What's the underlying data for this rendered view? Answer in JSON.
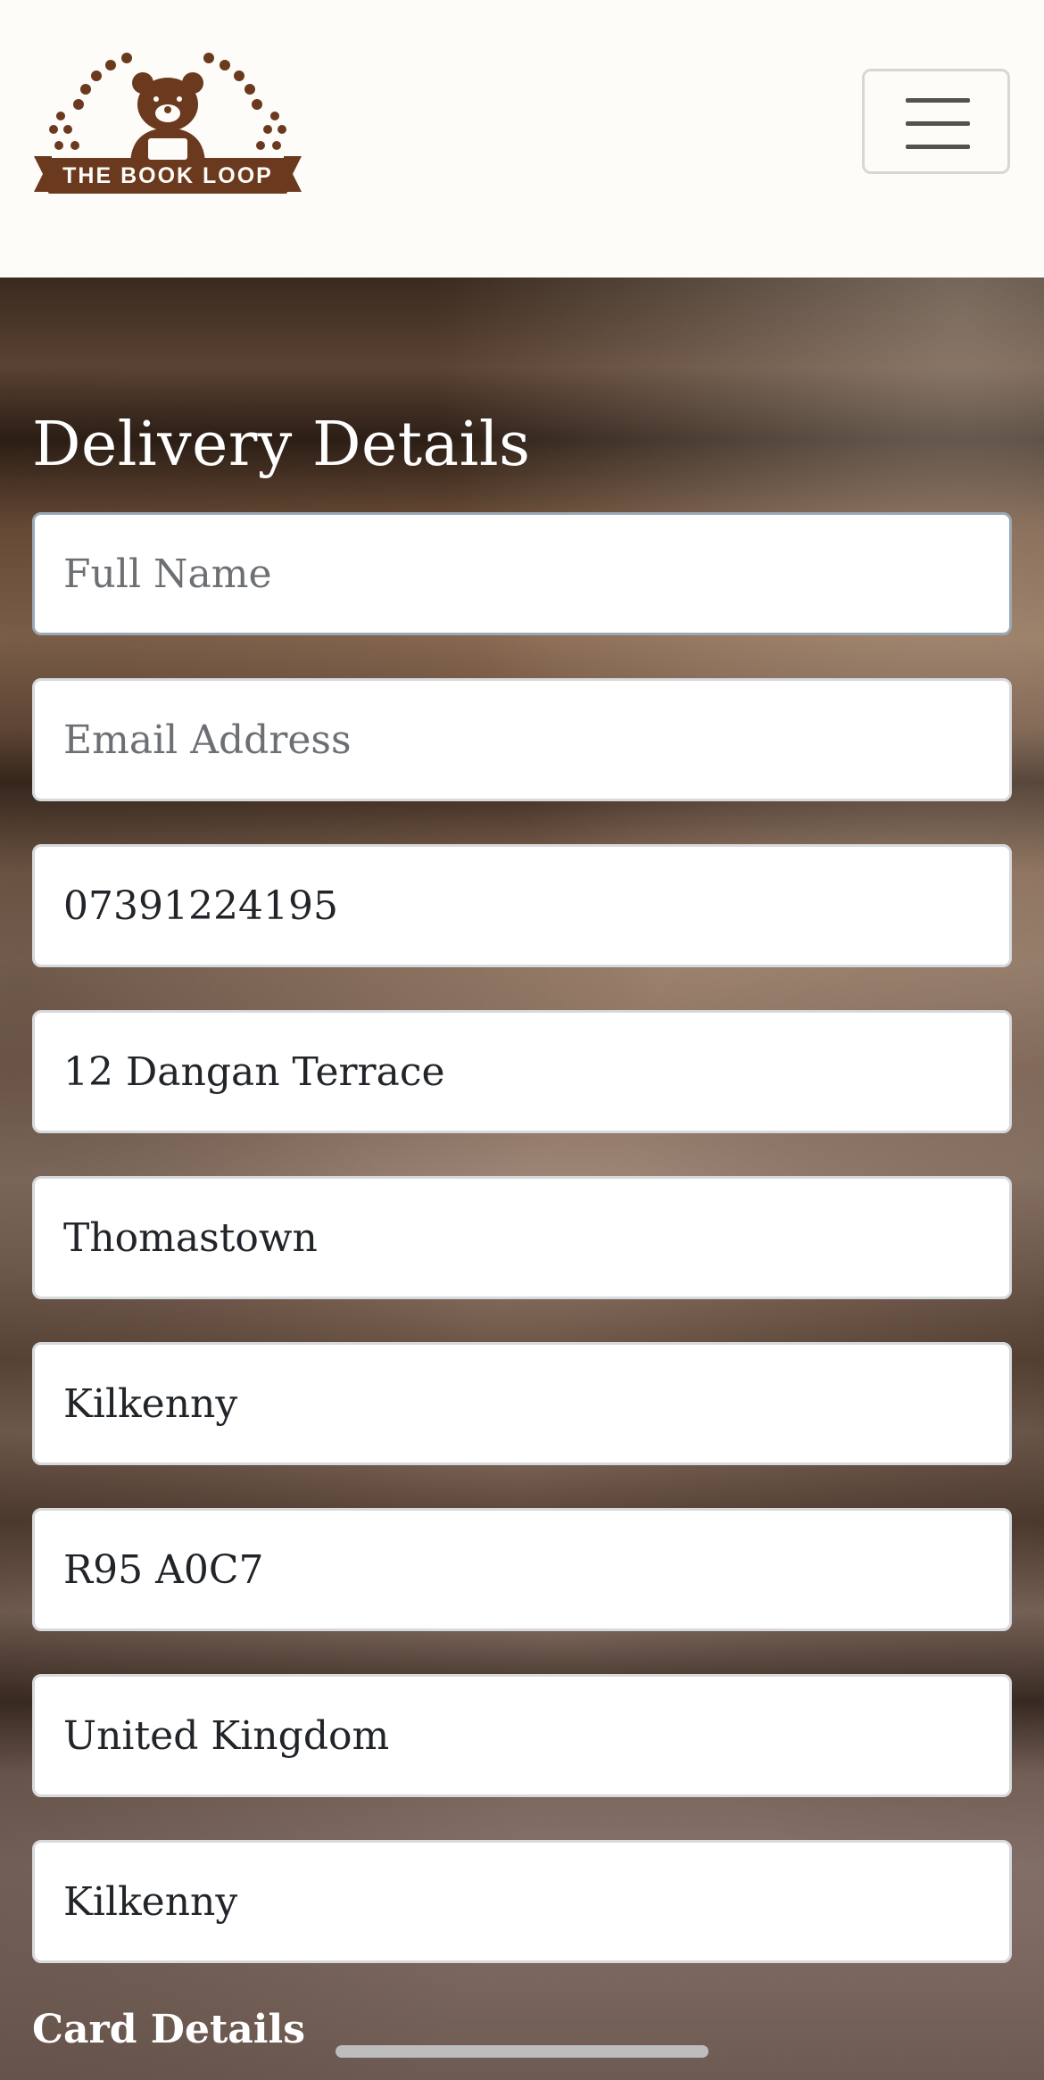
{
  "header": {
    "logo_text": "THE BOOK LOOP",
    "menu_icon": "hamburger-icon",
    "brand_color": "#6b3a1e"
  },
  "delivery": {
    "title": "Delivery Details",
    "fields": [
      {
        "name": "full-name-input",
        "placeholder": "Full Name",
        "value": ""
      },
      {
        "name": "email-input",
        "placeholder": "Email Address",
        "value": ""
      },
      {
        "name": "phone-input",
        "placeholder": "",
        "value": "07391224195"
      },
      {
        "name": "street-address-input",
        "placeholder": "",
        "value": "12 Dangan Terrace"
      },
      {
        "name": "town-city-input",
        "placeholder": "",
        "value": "Thomastown"
      },
      {
        "name": "county-input",
        "placeholder": "",
        "value": "Kilkenny"
      },
      {
        "name": "postcode-input",
        "placeholder": "",
        "value": "R95 A0C7"
      },
      {
        "name": "country-select",
        "placeholder": "",
        "value": "United Kingdom"
      },
      {
        "name": "county-input-2",
        "placeholder": "",
        "value": "Kilkenny"
      }
    ]
  },
  "card": {
    "title": "Card Details"
  }
}
